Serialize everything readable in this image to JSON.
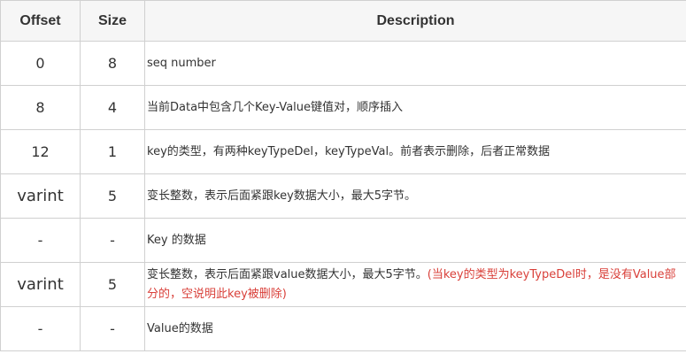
{
  "table": {
    "headers": {
      "offset": "Offset",
      "size": "Size",
      "description": "Description"
    },
    "rows": [
      {
        "offset": "0",
        "size": "8",
        "description": "seq number",
        "note": ""
      },
      {
        "offset": "8",
        "size": "4",
        "description": "当前Data中包含几个Key-Value键值对，顺序插入",
        "note": ""
      },
      {
        "offset": "12",
        "size": "1",
        "description": "key的类型，有两种keyTypeDel，keyTypeVal。前者表示删除，后者正常数据",
        "note": ""
      },
      {
        "offset": "varint",
        "size": "5",
        "description": "变长整数，表示后面紧跟key数据大小，最大5字节。",
        "note": ""
      },
      {
        "offset": "-",
        "size": "-",
        "description": "Key 的数据",
        "note": ""
      },
      {
        "offset": "varint",
        "size": "5",
        "description": "变长整数，表示后面紧跟value数据大小，最大5字节。",
        "note": "(当key的类型为keyTypeDel时，是没有Value部分的，空说明此key被删除)"
      },
      {
        "offset": "-",
        "size": "-",
        "description": "Value的数据",
        "note": ""
      }
    ]
  },
  "colors": {
    "border": "#d0d0d0",
    "header_bg": "#f6f6f6",
    "text": "#333333",
    "note": "#d9403a"
  }
}
